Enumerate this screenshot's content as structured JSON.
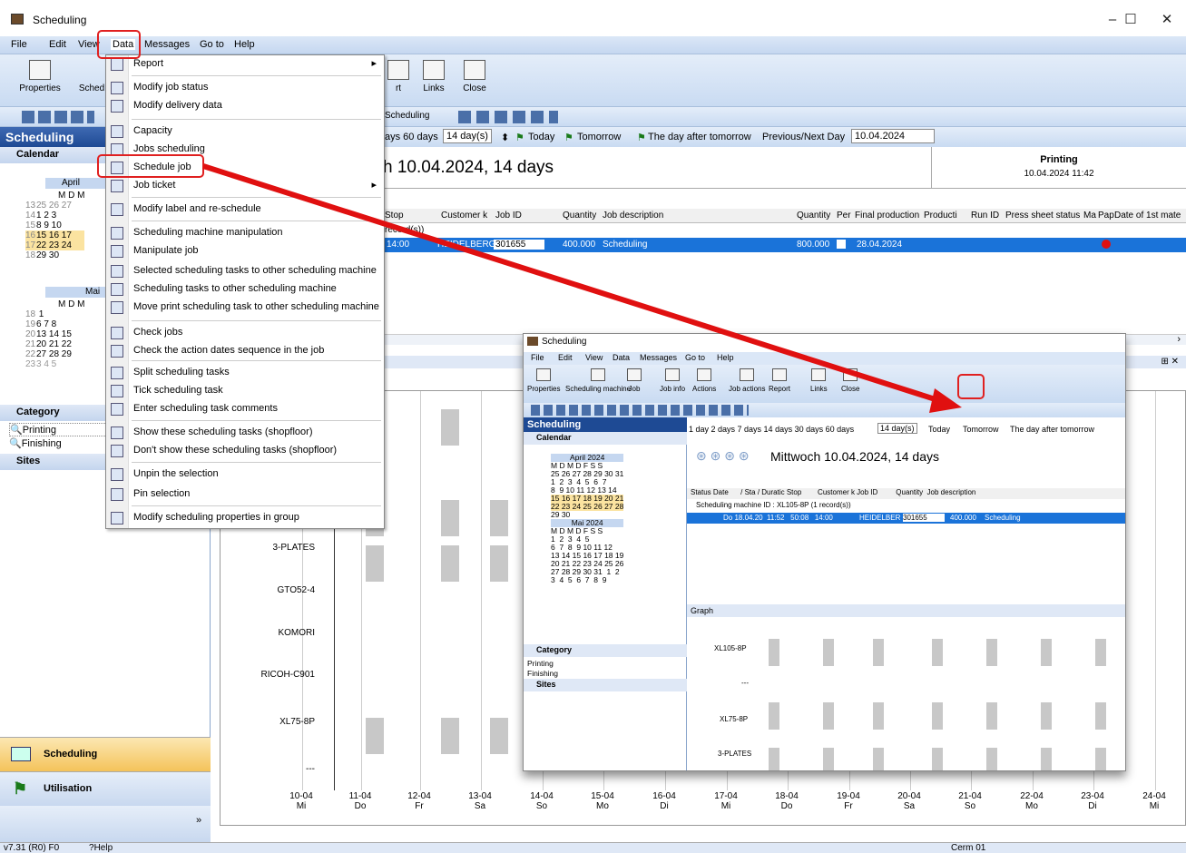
{
  "window": {
    "title": "Scheduling",
    "minimize": "–",
    "maximize": "☐",
    "close": "✕"
  },
  "menubar": [
    "File",
    "Edit",
    "View",
    "Data",
    "Messages",
    "Go to",
    "Help"
  ],
  "toolbar1": [
    {
      "label": "Properties"
    },
    {
      "label": "Sched"
    },
    {
      "label": "rt"
    },
    {
      "label": "Links"
    },
    {
      "label": "Close"
    }
  ],
  "toolbar2": {
    "scheduling_btn": "Scheduling"
  },
  "sidebar": {
    "header": "Scheduling",
    "calendar_label": "Calendar",
    "april": {
      "title": "April",
      "dow": "M D M",
      "weeks": [
        {
          "wk": "13",
          "days": "25 26 27"
        },
        {
          "wk": "14",
          "days": "1  2  3"
        },
        {
          "wk": "15",
          "days": "8  9  10"
        },
        {
          "wk": "16",
          "days": "15 16 17"
        },
        {
          "wk": "17",
          "days": "22 23 24"
        },
        {
          "wk": "18",
          "days": "29 30"
        }
      ]
    },
    "mai": {
      "title": "Mai",
      "dow": "M D M",
      "weeks": [
        {
          "wk": "18",
          "days": "      1"
        },
        {
          "wk": "19",
          "days": "6  7  8"
        },
        {
          "wk": "20",
          "days": "13 14 15"
        },
        {
          "wk": "21",
          "days": "20 21 22"
        },
        {
          "wk": "22",
          "days": "27 28 29"
        },
        {
          "wk": "23",
          "days": "3  4  5"
        }
      ]
    },
    "category_label": "Category",
    "categories": [
      "Printing",
      "Finishing"
    ],
    "sites_label": "Sites",
    "nav": [
      "Scheduling",
      "Utilisation"
    ],
    "more": "»"
  },
  "range_bar": {
    "items": "ays  60 days",
    "sel": "14 day(s)",
    "today": "Today",
    "tomorrow": "Tomorrow",
    "after": "The day after tomorrow",
    "prevnext": "Previous/Next Day",
    "date": "10.04.2024"
  },
  "datehead": {
    "title": "h 10.04.2024, 14 days"
  },
  "printing": {
    "label": "Printing",
    "datetime": "10.04.2024 11:42"
  },
  "grid": {
    "headers": [
      "Stop",
      "Customer k",
      "Job ID",
      "Quantity",
      "Job description",
      "Quantity",
      "Per",
      "Final production",
      "Producti",
      "Run ID",
      "Press sheet status",
      "Ma",
      "Pap",
      "Date of 1st mate"
    ],
    "group": "record(s))",
    "row": {
      "stop": "14:00",
      "customer": "HEIDELBERG",
      "jobid": "301655",
      "qty": "400.000",
      "desc": "Scheduling",
      "qty2": "800.000",
      "final": "28.04.2024"
    }
  },
  "menu": {
    "items": [
      {
        "label": "Report",
        "icon": "report-icon",
        "sub": true
      },
      {
        "label": "Modify job status",
        "icon": "status-icon"
      },
      {
        "label": "Modify delivery data",
        "icon": "delivery-icon"
      },
      {
        "label": "Capacity",
        "icon": "capacity-icon"
      },
      {
        "label": "Jobs scheduling",
        "icon": "jobs-icon"
      },
      {
        "label": "Schedule job",
        "icon": "schedule-icon"
      },
      {
        "label": "Job ticket",
        "icon": "ticket-icon",
        "sub": true
      },
      {
        "label": "Modify label and re-schedule",
        "icon": "relabel-icon"
      },
      {
        "label": "Scheduling machine manipulation",
        "icon": "machine-icon"
      },
      {
        "label": "Manipulate job",
        "icon": "manip-icon"
      },
      {
        "label": "Selected scheduling tasks to other scheduling machine",
        "icon": "move-icon"
      },
      {
        "label": "Scheduling tasks to other scheduling machine",
        "icon": "move-icon"
      },
      {
        "label": "Move print scheduling task to other scheduling machine",
        "icon": "move-icon"
      },
      {
        "label": "Check jobs",
        "icon": "check-icon"
      },
      {
        "label": "Check the action dates sequence in the job",
        "icon": "sequence-icon"
      },
      {
        "label": "Split scheduling tasks",
        "icon": "split-icon"
      },
      {
        "label": "Tick scheduling task",
        "icon": "tick-icon"
      },
      {
        "label": "Enter scheduling task comments",
        "icon": "comment-icon"
      },
      {
        "label": "Show these scheduling tasks (shopfloor)",
        "icon": "show-icon"
      },
      {
        "label": "Don't show these scheduling tasks (shopfloor)",
        "icon": "hide-icon"
      },
      {
        "label": "Unpin the selection",
        "icon": "unpin-icon"
      },
      {
        "label": "Pin selection",
        "icon": "pin-icon"
      },
      {
        "label": "Modify scheduling properties in group",
        "icon": "props-icon"
      }
    ]
  },
  "graph": {
    "machines": [
      "3-PLATES",
      "GTO52-4",
      "KOMORI",
      "RICOH-C901",
      "XL75-8P",
      "---"
    ],
    "dates": [
      {
        "d": "10-04",
        "w": "Mi"
      },
      {
        "d": "11-04",
        "w": "Do"
      },
      {
        "d": "12-04",
        "w": "Fr"
      },
      {
        "d": "13-04",
        "w": "Sa"
      },
      {
        "d": "14-04",
        "w": "So"
      },
      {
        "d": "15-04",
        "w": "Mo"
      },
      {
        "d": "16-04",
        "w": "Di"
      },
      {
        "d": "17-04",
        "w": "Mi"
      },
      {
        "d": "18-04",
        "w": "Do"
      },
      {
        "d": "19-04",
        "w": "Fr"
      },
      {
        "d": "20-04",
        "w": "Sa"
      },
      {
        "d": "21-04",
        "w": "So"
      },
      {
        "d": "22-04",
        "w": "Mo"
      },
      {
        "d": "23-04",
        "w": "Di"
      },
      {
        "d": "24-04",
        "w": "Mi"
      }
    ]
  },
  "inset": {
    "title": "Scheduling",
    "menubar": [
      "File",
      "Edit",
      "View",
      "Data",
      "Messages",
      "Go to",
      "Help"
    ],
    "toolbar": [
      "Properties",
      "Scheduling machine",
      "Job",
      "Job info",
      "Actions",
      "Job actions",
      "Report",
      "Links",
      "Close"
    ],
    "sidebar_header": "Scheduling",
    "calendar": "Calendar",
    "april": "April 2024",
    "mai": "Mai 2024",
    "dow": "M D M D F S S",
    "april_weeks": [
      "25 26 27 28 29 30 31",
      "1  2  3  4  5  6  7",
      "8  9 10 11 12 13 14",
      "15 16 17 18 19 20 21",
      "22 23 24 25 26 27 28",
      "29 30"
    ],
    "mai_weeks": [
      "1  2  3  4  5",
      "6  7  8  9 10 11 12",
      "13 14 15 16 17 18 19",
      "20 21 22 23 24 25 26",
      "27 28 29 30 31  1  2",
      "3  4  5  6  7  8  9"
    ],
    "category": "Category",
    "cats": [
      "Printing",
      "Finishing"
    ],
    "sites": "Sites",
    "range": "1 day  2 days  7 days  14 days  30 days  60 days",
    "range_sel": "14 day(s)",
    "today": "Today",
    "tomorrow": "Tomorrow",
    "after": "The day after tomorrow",
    "heading": "Mittwoch 10.04.2024, 14 days",
    "grid_headers": "Status Date      / Sta / Duratic Stop        Customer k Job ID         Quantity  Job description",
    "group": "Scheduling machine ID : XL105-8P (1 record(s))",
    "row": "Do 18.04.20  11:52   50:08   14:00",
    "row_customer": "HEIDELBER",
    "row_job": "301655",
    "row_qty": "400.000",
    "row_desc": "Scheduling",
    "graph_label": "Graph",
    "machines": [
      "XL105-8P",
      "---",
      "XL75-8P",
      "3-PLATES"
    ]
  },
  "status": {
    "version": "v7.31 (R0) F0",
    "help": "Help",
    "user": "Cerm 01"
  }
}
